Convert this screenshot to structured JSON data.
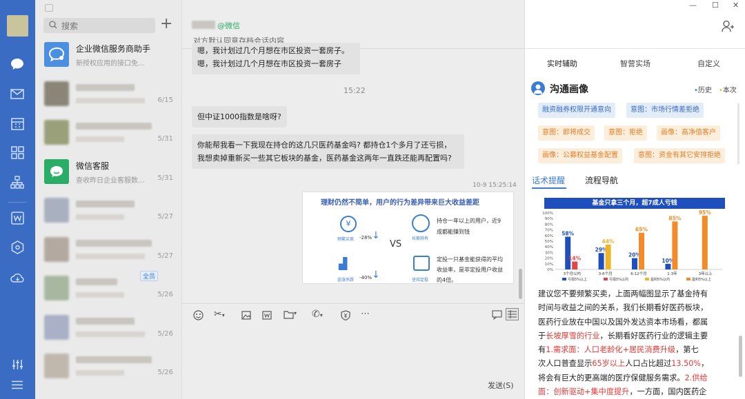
{
  "window": {
    "minimize": "—",
    "maximize": "☐",
    "close": "✕"
  },
  "rail": {
    "active": "chat"
  },
  "search": {
    "placeholder": "搜索",
    "add": "+"
  },
  "contacts": [
    {
      "name": "企业微信服务商助手",
      "preview": "新授权应用的接口免...",
      "date": "",
      "avatar": "#4a8fe0",
      "blurred": false
    },
    {
      "name": "",
      "preview": "",
      "date": "6/15",
      "avatar": "#8a8577",
      "blurred": true
    },
    {
      "name": "",
      "preview": "",
      "date": "5/31",
      "avatar": "#9aa07a",
      "blurred": true
    },
    {
      "name": "微信客服",
      "preview": "查收昨日企业客服数...",
      "date": "5/31",
      "avatar": "#2aae67",
      "blurred": false
    },
    {
      "name": "",
      "preview": "",
      "date": "5/27",
      "avatar": "#a9b0c0",
      "blurred": true
    },
    {
      "name": "",
      "preview": "",
      "date": "5/27",
      "avatar": "#b3a9a0",
      "blurred": true
    },
    {
      "name": "",
      "preview": "",
      "date": "5/26",
      "avatar": "#a8b8a0",
      "blurred": true,
      "badge": "全员"
    },
    {
      "name": "",
      "preview": "",
      "date": "5/26",
      "avatar": "#aab0c6",
      "blurred": true
    },
    {
      "name": "",
      "preview": "",
      "date": "5/26",
      "avatar": "#c0b8ac",
      "blurred": true
    }
  ],
  "chat": {
    "contact_suffix": "@微信",
    "subtitle": "对方默认同意存档会话内容",
    "msg1_line1": "嗯，我计划过几个月想在市区投资一套房子。",
    "msg1_line2": "嗯，我计划过几个月想在市区投资一套房子",
    "time1": "15:22",
    "msg2": "但中证1000指数是啥呀?",
    "msg3": "你能帮我看一下我现在持仓的这几只医药基金吗? 都持仓1个多月了还亏损，我想卖掉重新买一些其它板块的基金，医药基金这两年一直跌还能再配置吗?",
    "time2": "10-9 15:25:14",
    "card_title": "理财仍然不简单，用户的行为差异带来巨大收益差距",
    "card_vs": "VS",
    "card_left1_label": "频繁买卖",
    "card_left1_pct": "-28%",
    "card_left2_label": "追涨杀跌",
    "card_left2_pct": "-40%",
    "card_right1_text": "持仓一年以上的用户，近9成都能赚到钱",
    "card_right1_label": "长期持有",
    "card_right2_text": "定投一只基金能获得的平均收益率，是非定投用户收益的4倍。",
    "card_right2_label": "坚持定投",
    "send": "发送(S)"
  },
  "right": {
    "tabs": [
      "实时辅助",
      "智营实场",
      "自定义"
    ],
    "section_title": "沟通画像",
    "history": "历史",
    "this_time": "本次",
    "tags": [
      {
        "text": "融资融券权限开通意向",
        "type": "b"
      },
      {
        "text": "意图：市场行情差拒绝",
        "type": "b"
      },
      {
        "text": "意图：即将成交",
        "type": "o"
      },
      {
        "text": "意图：拒绝",
        "type": "o"
      },
      {
        "text": "画像：高净值客户",
        "type": "o"
      },
      {
        "text": "画像：公募权益基金配置",
        "type": "o"
      },
      {
        "text": "意图：资金有其它安排拒绝",
        "type": "o"
      }
    ],
    "subtabs": [
      "话术提醒",
      "流程导航"
    ],
    "chart_banner": "基金只拿三个月，超7成人亏钱",
    "advice_lines": [
      [
        {
          "t": "建议您不要频繁买卖，上面两幅图显示了基金持有"
        }
      ],
      [
        {
          "t": "时间与收益之间的关系，我们长期看好医药板块，"
        }
      ],
      [
        {
          "t": "医药行业放在中国以及国外发达资本市场看，都属"
        }
      ],
      [
        {
          "t": "于"
        },
        {
          "t": "长坡厚雪的行业",
          "r": true
        },
        {
          "t": "，长期看好医药行业的逻辑主要"
        }
      ],
      [
        {
          "t": "有"
        },
        {
          "t": "1.需求面：人口老龄化+居民消费升级",
          "r": true
        },
        {
          "t": "，第七"
        }
      ],
      [
        {
          "t": "次人口普查显示"
        },
        {
          "t": "65岁以上",
          "r": true
        },
        {
          "t": "人口占比超过"
        },
        {
          "t": "13.50%",
          "r": true
        },
        {
          "t": "，"
        }
      ],
      [
        {
          "t": "将会有巨大的更高端的医疗保健服务需求。"
        },
        {
          "t": "2.供给",
          "r": true
        }
      ],
      [
        {
          "t": "面：创新驱动+集中度提升",
          "r": true
        },
        {
          "t": "，一方面，国内医药企"
        }
      ]
    ]
  },
  "chart_data": {
    "type": "bar",
    "title": "基金只拿三个月，超7成人亏钱",
    "categories": [
      "3个月以内",
      "3-6个月",
      "6-12个月",
      "1-3年",
      "3年以上"
    ],
    "series": [
      {
        "name": "亏损5%以上",
        "color": "#1f4fbf",
        "values": [
          58,
          29,
          20,
          10,
          null
        ]
      },
      {
        "name": "亏损5%以内",
        "color": "#e54444",
        "values": [
          14,
          null,
          null,
          null,
          null
        ]
      },
      {
        "name": "盈利5%以内",
        "color": "#f0b429",
        "values": [
          null,
          44,
          null,
          null,
          null
        ]
      },
      {
        "name": "盈利5%以上",
        "color": "#f28c28",
        "values": [
          null,
          null,
          65,
          85,
          95
        ]
      }
    ],
    "ylim": [
      0,
      100
    ],
    "yticks": [
      "100%",
      "90%",
      "80%",
      "70%",
      "60%",
      "50%",
      "40%",
      "30%",
      "20%",
      "10%",
      "0%"
    ]
  }
}
